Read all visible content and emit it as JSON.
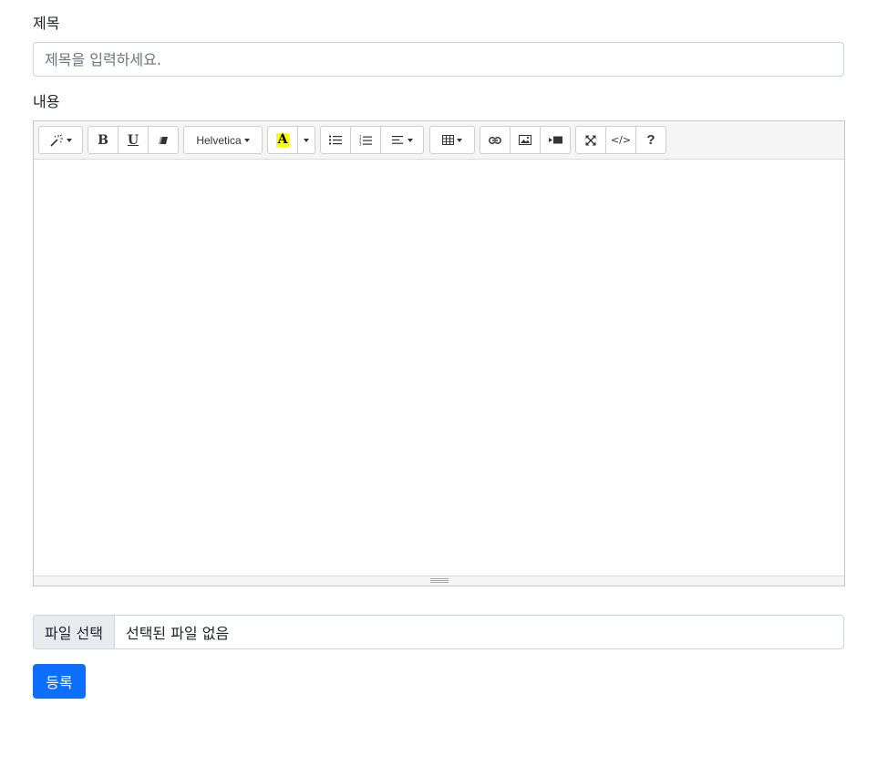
{
  "form": {
    "title_label": "제목",
    "title_placeholder": "제목을 입력하세요.",
    "title_value": "",
    "content_label": "내용"
  },
  "toolbar": {
    "style_icon": "magic-icon",
    "bold": "B",
    "underline": "U",
    "eraser_icon": "eraser-icon",
    "font_name": "Helvetica",
    "color_letter": "A",
    "color_highlight": "#ffff00",
    "unordered_list_icon": "unordered-list-icon",
    "ordered_list_icon": "ordered-list-icon",
    "align_icon": "align-left-icon",
    "table_icon": "table-icon",
    "link_icon": "link-icon",
    "picture_icon": "picture-icon",
    "video_icon": "video-icon",
    "fullscreen_icon": "fullscreen-icon",
    "codeview": "</>",
    "help": "?"
  },
  "file": {
    "button_label": "파일 선택",
    "status_text": "선택된 파일 없음"
  },
  "submit": {
    "label": "등록",
    "color": "#0d6efd"
  }
}
